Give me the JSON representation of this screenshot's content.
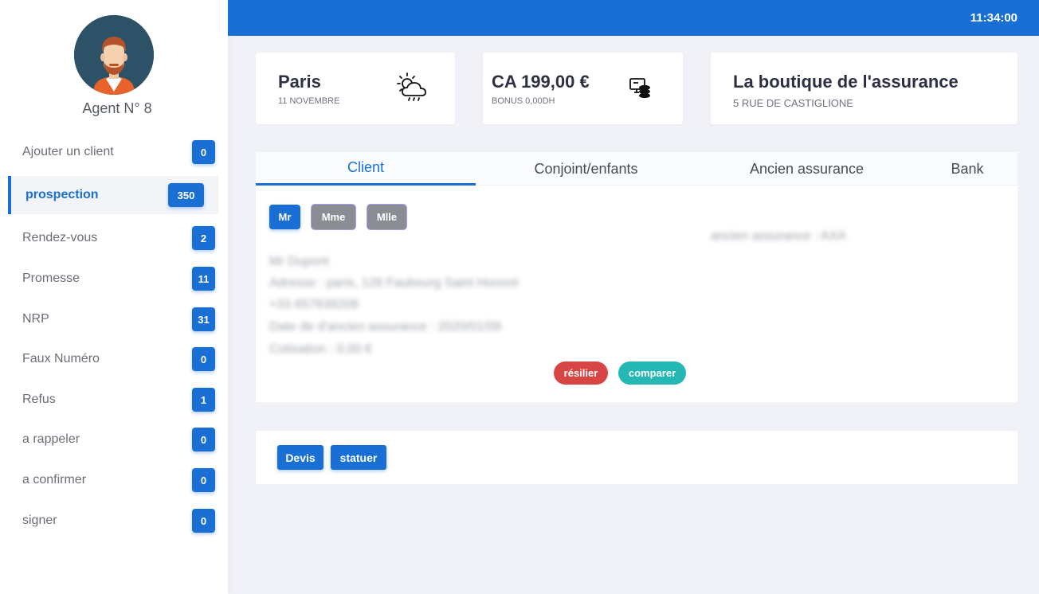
{
  "sidebar": {
    "agent_name": "Agent N° 8",
    "items": [
      {
        "label": "Ajouter un client",
        "count": "0"
      },
      {
        "label": "prospection",
        "count": "350"
      },
      {
        "label": "Rendez-vous",
        "count": "2"
      },
      {
        "label": "Promesse",
        "count": "11"
      },
      {
        "label": "NRP",
        "count": "31"
      },
      {
        "label": "Faux Numéro",
        "count": "0"
      },
      {
        "label": "Refus",
        "count": "1"
      },
      {
        "label": "a rappeler",
        "count": "0"
      },
      {
        "label": "a confirmer",
        "count": "0"
      },
      {
        "label": "signer",
        "count": "0"
      }
    ]
  },
  "header": {
    "clock": "11:34:00"
  },
  "cards": {
    "weather": {
      "city": "Paris",
      "date": "11 NOVEMBRE",
      "icon": "weather-partly-cloudy-rain-icon"
    },
    "revenue": {
      "amount": "CA 199,00 €",
      "bonus": "BONUS 0,00DH",
      "icon": "finance-monitor-coins-icon"
    },
    "shop": {
      "name": "La boutique de l'assurance",
      "address": "5 RUE DE CASTIGLIONE"
    }
  },
  "tabs": [
    "Client",
    "Conjoint/enfants",
    "Ancien assurance",
    "Bank"
  ],
  "client": {
    "civility": [
      "Mr",
      "Mme",
      "Mlle"
    ],
    "previous_insurance": "ancien assurance : AXA",
    "name": "Mr Dupont",
    "address": "Adresse : paris, 128 Faubourg Saint Honoré",
    "phone": "+33 657839208",
    "old_insurance_date": "Date de d'ancien assurance : 2020/01/09",
    "contribution": "Cotisation : 0,00 €",
    "resilier_label": "résilier",
    "comparer_label": "comparer"
  },
  "actions": {
    "devis_label": "Devis",
    "statuer_label": "statuer"
  },
  "colors": {
    "primary": "#1a6fd4",
    "danger": "#d84545",
    "teal": "#25b7b3",
    "grey": "#8a8d93"
  }
}
